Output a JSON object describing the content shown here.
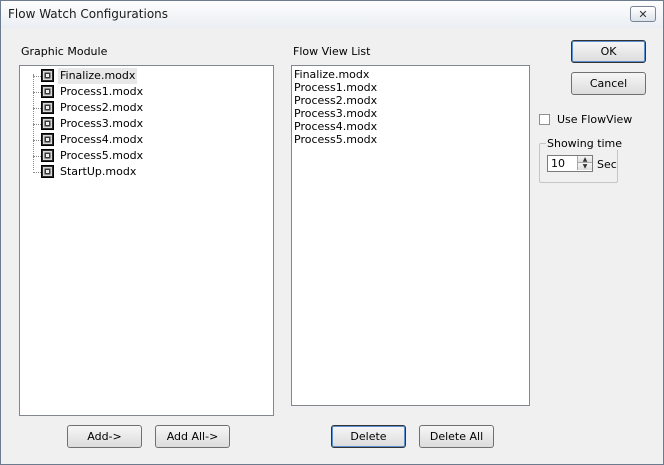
{
  "window": {
    "title": "Flow Watch Configurations"
  },
  "graphic_module": {
    "label": "Graphic Module",
    "items": [
      {
        "label": "Finalize.modx",
        "selected": true
      },
      {
        "label": "Process1.modx",
        "selected": false
      },
      {
        "label": "Process2.modx",
        "selected": false
      },
      {
        "label": "Process3.modx",
        "selected": false
      },
      {
        "label": "Process4.modx",
        "selected": false
      },
      {
        "label": "Process5.modx",
        "selected": false
      },
      {
        "label": "StartUp.modx",
        "selected": false
      }
    ],
    "add_label": "Add->",
    "add_all_label": "Add All->"
  },
  "flow_view_list": {
    "label": "Flow View List",
    "items": [
      "Finalize.modx",
      "Process1.modx",
      "Process2.modx",
      "Process3.modx",
      "Process4.modx",
      "Process5.modx"
    ],
    "delete_label": "Delete",
    "delete_all_label": "Delete All"
  },
  "buttons": {
    "ok_label": "OK",
    "cancel_label": "Cancel"
  },
  "use_flowview": {
    "label": "Use FlowView",
    "checked": false
  },
  "showing_time": {
    "title": "Showing time",
    "value": "10",
    "unit": "Sec"
  },
  "icons": {
    "close": "close-icon",
    "file": "file-icon"
  }
}
